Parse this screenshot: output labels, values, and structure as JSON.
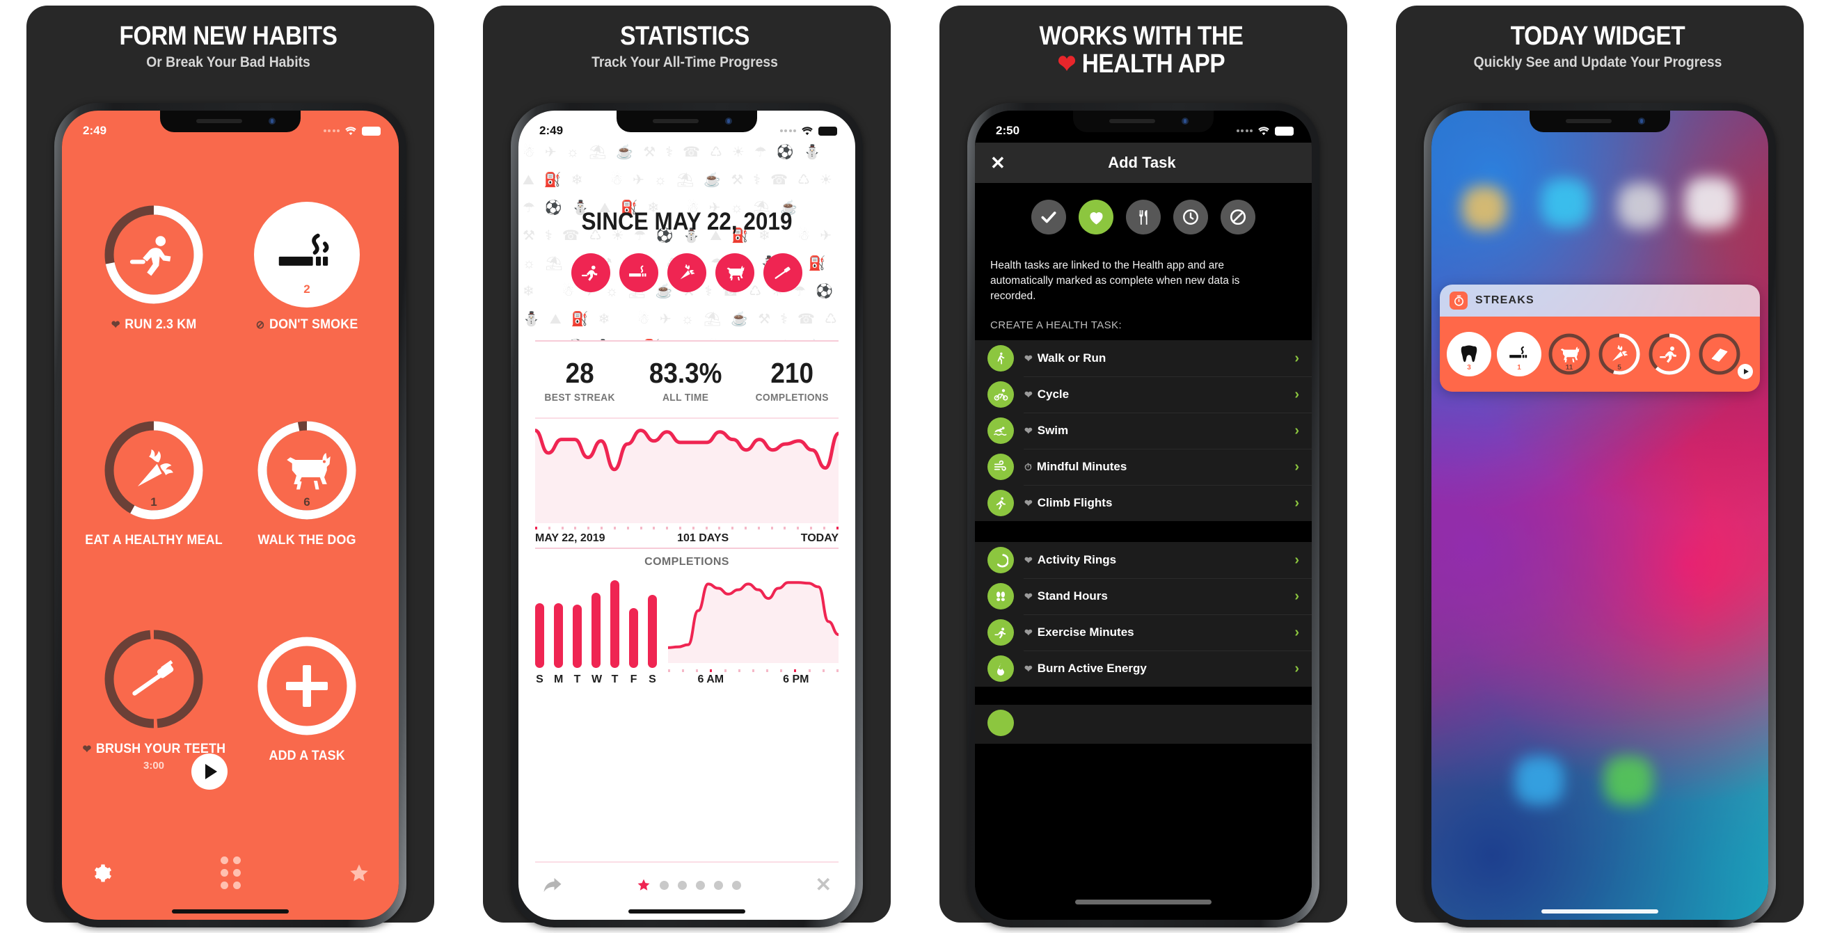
{
  "panels": [
    {
      "caption_title": "FORM NEW HABITS",
      "caption_sub": "Or Break Your Bad Habits",
      "status": {
        "time": "2:49",
        "wifi": "wifi-icon",
        "battery": "battery-icon"
      },
      "habits": [
        {
          "label": "RUN 2.3 KM",
          "icon": "runner-icon",
          "heart": true,
          "progress": 0.72,
          "style": "ring",
          "count": "",
          "sub": ""
        },
        {
          "label": "DON'T SMOKE",
          "icon": "cigarette-icon",
          "heart": false,
          "banned": true,
          "progress": 1,
          "style": "filled",
          "count": "2",
          "sub": ""
        },
        {
          "label": "EAT A HEALTHY MEAL",
          "icon": "carrot-icon",
          "heart": false,
          "progress": 0.58,
          "style": "ring",
          "count": "1",
          "sub": ""
        },
        {
          "label": "WALK THE DOG",
          "icon": "dog-icon",
          "heart": false,
          "progress": 0.97,
          "style": "ring",
          "count": "6",
          "sub": ""
        },
        {
          "label": "BRUSH YOUR TEETH",
          "icon": "toothbrush-icon",
          "heart": true,
          "progress": 0,
          "style": "ring",
          "count": "",
          "sub": "3:00",
          "play": true
        },
        {
          "label": "ADD A TASK",
          "icon": "plus-icon",
          "heart": false,
          "progress": 1,
          "style": "ring",
          "count": "",
          "sub": ""
        }
      ],
      "toolbar": {
        "settings": "gear-icon",
        "grid": "grid-dots-icon",
        "star": "star-icon"
      }
    },
    {
      "caption_title": "STATISTICS",
      "caption_sub": "Track Your All-Time Progress",
      "status": {
        "time": "2:49"
      },
      "hero_title": "SINCE MAY 22, 2019",
      "hero_icons": [
        "runner-icon",
        "cigarette-icon",
        "carrot-icon",
        "dog-icon",
        "toothbrush-icon"
      ],
      "stats": [
        {
          "value": "28",
          "label": "BEST STREAK"
        },
        {
          "value": "83.3%",
          "label": "ALL TIME"
        },
        {
          "value": "210",
          "label": "COMPLETIONS"
        }
      ],
      "axis": {
        "left": "MAY 22, 2019",
        "center": "101 DAYS",
        "right": "TODAY"
      },
      "completions_label": "COMPLETIONS",
      "time_axis": {
        "left": "6 AM",
        "right": "6 PM"
      },
      "toolbar": {
        "share": "share-icon",
        "close": "close-icon",
        "active_dot": "star-icon",
        "dot_count": 5
      }
    },
    {
      "caption_title_line1": "WORKS WITH THE",
      "caption_title_line2": "HEALTH APP",
      "caption_heart": "heart-icon",
      "status": {
        "time": "2:50"
      },
      "nav": {
        "close": "close-icon",
        "title": "Add Task"
      },
      "type_icons": [
        {
          "name": "check-icon",
          "active": false
        },
        {
          "name": "heart-icon",
          "active": true
        },
        {
          "name": "cutlery-icon",
          "active": false
        },
        {
          "name": "clock-icon",
          "active": false
        },
        {
          "name": "no-entry-icon",
          "active": false
        }
      ],
      "description": "Health tasks are linked to the Health app and are automatically marked as complete when new data is recorded.",
      "section_header": "CREATE A HEALTH TASK:",
      "group1": [
        {
          "label": "Walk or Run",
          "icon": "walk-icon",
          "badge": "heart"
        },
        {
          "label": "Cycle",
          "icon": "cycle-icon",
          "badge": "heart"
        },
        {
          "label": "Swim",
          "icon": "swim-icon",
          "badge": "heart"
        },
        {
          "label": "Mindful Minutes",
          "icon": "wind-icon",
          "badge": "clock"
        },
        {
          "label": "Climb Flights",
          "icon": "climb-icon",
          "badge": "heart"
        }
      ],
      "group2": [
        {
          "label": "Activity Rings",
          "icon": "rings-icon",
          "badge": "heart"
        },
        {
          "label": "Stand Hours",
          "icon": "footprints-icon",
          "badge": "heart"
        },
        {
          "label": "Exercise Minutes",
          "icon": "runner-icon",
          "badge": "heart"
        },
        {
          "label": "Burn Active Energy",
          "icon": "flame-icon",
          "badge": "heart"
        }
      ]
    },
    {
      "caption_title": "TODAY WIDGET",
      "caption_sub": "Quickly See and Update Your Progress",
      "widget": {
        "app_icon": "streaks-app-icon",
        "title": "STREAKS",
        "items": [
          {
            "icon": "tooth-icon",
            "count": "3",
            "style": "filled",
            "progress": 1
          },
          {
            "icon": "cigarette-icon",
            "count": "1",
            "style": "filled",
            "progress": 1
          },
          {
            "icon": "dog-icon",
            "count": "11",
            "style": "ring",
            "progress": 0
          },
          {
            "icon": "carrot-icon",
            "count": "5",
            "style": "ring",
            "progress": 0.55
          },
          {
            "icon": "runner-icon",
            "count": "",
            "style": "ring",
            "progress": 0.62
          },
          {
            "icon": "book-icon",
            "count": "",
            "style": "ring",
            "progress": 0.05,
            "play": true
          }
        ]
      }
    }
  ],
  "colors": {
    "brand_orange": "#f9694c",
    "brand_pink": "#ef2552",
    "health_green": "#8cc63f",
    "ring_dark": "#6b4037",
    "card_bg": "#282828"
  },
  "chart_data": [
    {
      "type": "line",
      "title": "All-time completion rate",
      "xlabel": "101 DAYS",
      "x_tick_labels": [
        "MAY 22, 2019",
        "101 DAYS",
        "TODAY"
      ],
      "ylim": [
        0,
        100
      ],
      "grid": false,
      "legend": "none",
      "values": [
        92,
        62,
        80,
        80,
        56,
        78,
        40,
        74,
        92,
        78,
        90,
        76,
        76,
        76,
        90,
        80,
        66,
        80,
        66,
        74,
        78,
        66,
        42,
        88
      ]
    },
    {
      "type": "bar",
      "title": "COMPLETIONS",
      "categories": [
        "S",
        "M",
        "T",
        "W",
        "T",
        "F",
        "S"
      ],
      "values": [
        74,
        74,
        72,
        86,
        100,
        68,
        83
      ],
      "ylim": [
        0,
        100
      ],
      "grid": false,
      "legend": "none"
    },
    {
      "type": "area",
      "title": "Completions by time of day",
      "x_tick_labels": [
        "6 AM",
        "6 PM"
      ],
      "ylim": [
        0,
        100
      ],
      "grid": false,
      "legend": "none",
      "values": [
        4,
        5,
        8,
        55,
        92,
        86,
        78,
        84,
        92,
        84,
        72,
        86,
        94,
        94,
        93,
        88,
        40,
        22
      ]
    }
  ]
}
